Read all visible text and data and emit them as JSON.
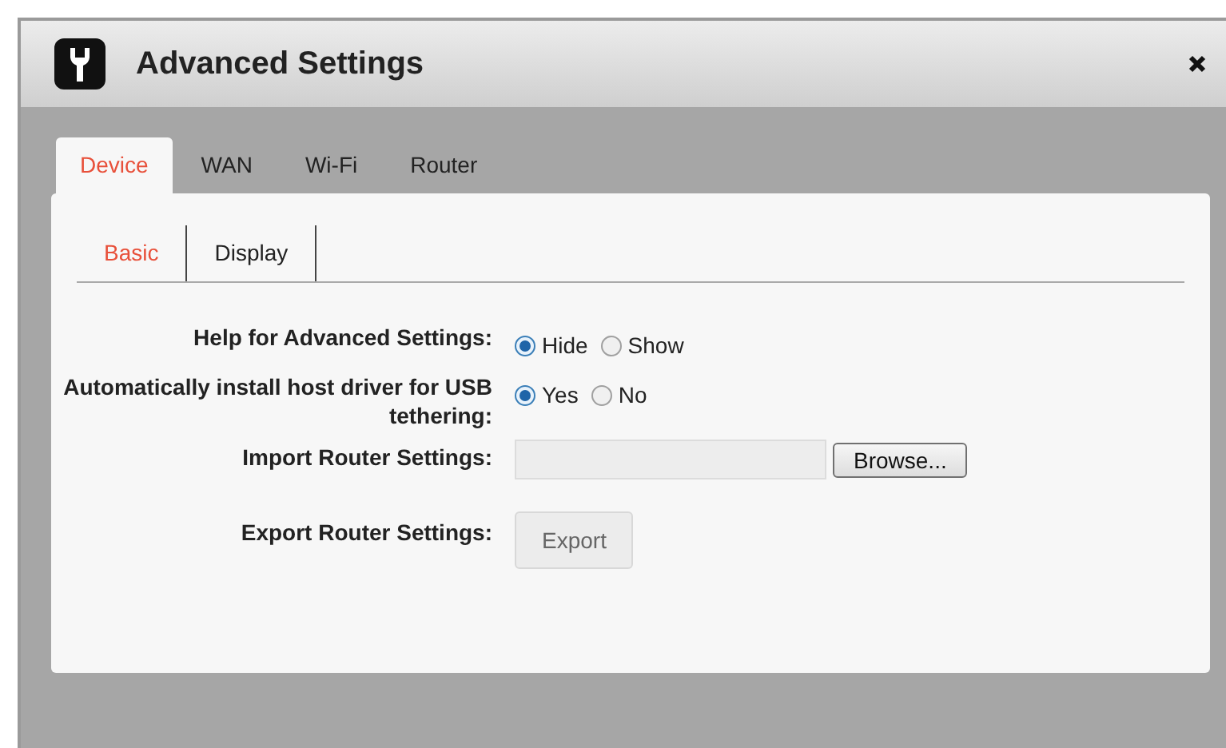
{
  "window": {
    "title": "Advanced Settings"
  },
  "tabs": [
    {
      "label": "Device",
      "selected": true
    },
    {
      "label": "WAN",
      "selected": false
    },
    {
      "label": "Wi-Fi",
      "selected": false
    },
    {
      "label": "Router",
      "selected": false
    }
  ],
  "subtabs": [
    {
      "label": "Basic",
      "selected": true
    },
    {
      "label": "Display",
      "selected": false
    }
  ],
  "settings": [
    {
      "kind": "radio",
      "label": "Help for Advanced Settings:",
      "options": [
        {
          "label": "Hide",
          "selected": true
        },
        {
          "label": "Show",
          "selected": false
        }
      ]
    },
    {
      "kind": "radio",
      "label": "Automatically install host driver for USB tethering:",
      "options": [
        {
          "label": "Yes",
          "selected": true
        },
        {
          "label": "No",
          "selected": false
        }
      ]
    },
    {
      "kind": "file",
      "label": "Import Router Settings:",
      "button": "Browse..."
    },
    {
      "kind": "button",
      "label": "Export Router Settings:",
      "button": "Export",
      "disabled": true
    }
  ]
}
